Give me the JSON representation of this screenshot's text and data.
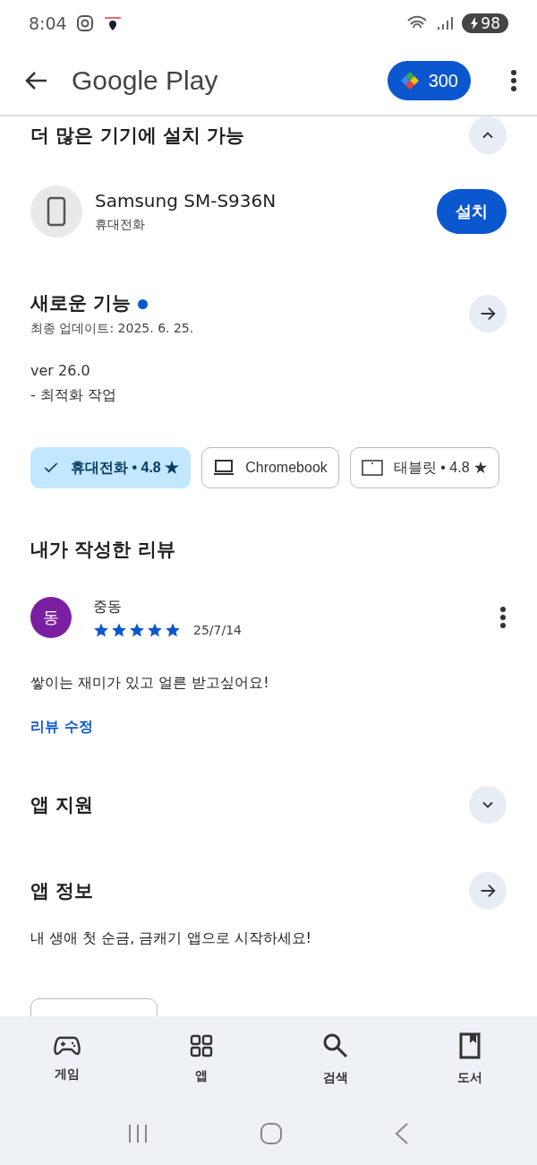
{
  "status_bar": {
    "time": "8:04",
    "battery": "98"
  },
  "header": {
    "title": "Google Play",
    "points": "300"
  },
  "devices_section": {
    "title": "더 많은 기기에 설치 가능",
    "expanded": true,
    "device": {
      "name": "Samsung SM-S936N",
      "type": "휴대전화",
      "button": "설치"
    }
  },
  "whats_new": {
    "title": "새로운 기능",
    "updated": "최종 업데이트: 2025. 6. 25.",
    "lines": [
      "ver 26.0",
      "- 최적화 작업"
    ]
  },
  "device_chips": [
    {
      "kind": "phone",
      "label": "휴대전화 • 4.8 ★",
      "selected": true
    },
    {
      "kind": "laptop",
      "label": "Chromebook",
      "selected": false
    },
    {
      "kind": "tablet",
      "label": "태블릿 • 4.8 ★",
      "selected": false
    }
  ],
  "my_review": {
    "title": "내가 작성한 리뷰",
    "author": "중동",
    "avatar": "동",
    "stars": 5,
    "date": "25/7/14",
    "text": "쌓이는 재미가 있고 얼른 받고싶어요!",
    "edit_link": "리뷰 수정"
  },
  "app_support": {
    "title": "앱 지원",
    "expanded": false
  },
  "app_info": {
    "title": "앱 정보",
    "description": "내 생애 첫 순금, 금캐기 앱으로 시작하세요!"
  },
  "bottom_nav": [
    {
      "kind": "games",
      "label": "게임"
    },
    {
      "kind": "apps",
      "label": "앱"
    },
    {
      "kind": "search",
      "label": "검색"
    },
    {
      "kind": "books",
      "label": "도서"
    }
  ]
}
